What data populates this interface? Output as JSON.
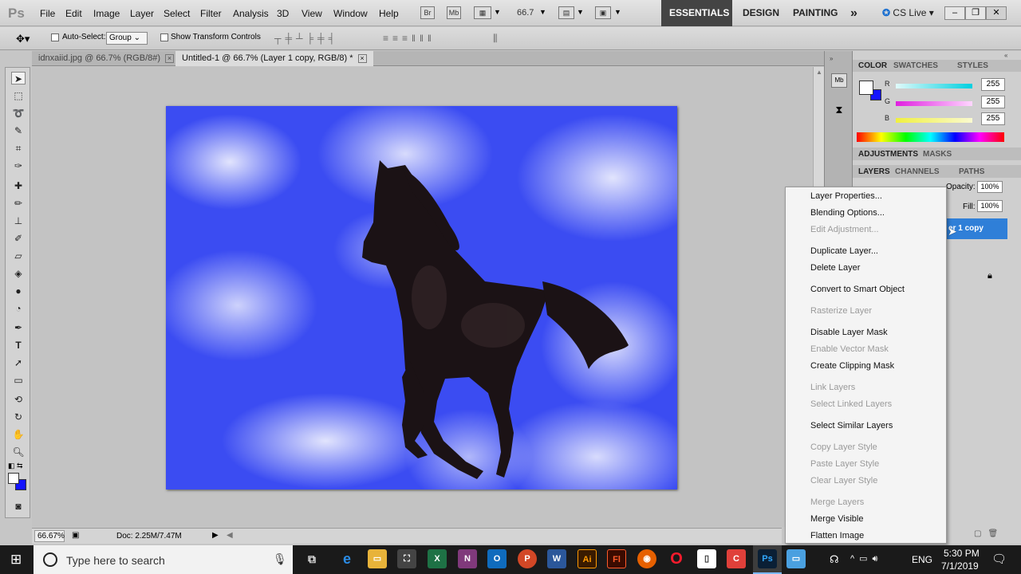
{
  "app": {
    "logo": "Ps"
  },
  "menu": [
    "File",
    "Edit",
    "Image",
    "Layer",
    "Select",
    "Filter",
    "Analysis",
    "3D",
    "View",
    "Window",
    "Help"
  ],
  "menubar_icons": [
    "Br",
    "Mb"
  ],
  "zoom_dropdown": "66.7",
  "workspaces": [
    "ESSENTIALS",
    "DESIGN",
    "PAINTING"
  ],
  "workspace_more": "»",
  "cs_live": "CS Live",
  "options_bar": {
    "auto_select_label": "Auto-Select:",
    "auto_select_value": "Group",
    "transform_label": "Show Transform Controls"
  },
  "doc_tabs": [
    {
      "label": "idnxaiid.jpg @ 66.7% (RGB/8#)",
      "active": false
    },
    {
      "label": "Untitled-1 @ 66.7% (Layer 1 copy, RGB/8) *",
      "active": true
    }
  ],
  "status": {
    "zoom": "66.67%",
    "doc": "Doc: 2.25M/7.47M"
  },
  "panels": {
    "color_tabs": [
      "COLOR",
      "SWATCHES",
      "STYLES"
    ],
    "channels": [
      {
        "label": "R",
        "value": "255",
        "color": "#00c8d8"
      },
      {
        "label": "G",
        "value": "255",
        "color": "#e020e0"
      },
      {
        "label": "B",
        "value": "255",
        "color": "#e0e020"
      }
    ],
    "adjust_tabs": [
      "ADJUSTMENTS",
      "MASKS"
    ],
    "layer_tabs": [
      "LAYERS",
      "CHANNELS",
      "PATHS"
    ],
    "opacity_label": "Opacity:",
    "opacity": "100%",
    "fill_label": "Fill:",
    "fill": "100%",
    "selected_layer": "er 1 copy"
  },
  "context_menu": [
    {
      "label": "Layer Properties...",
      "enabled": true
    },
    {
      "label": "Blending Options...",
      "enabled": true
    },
    {
      "label": "Edit Adjustment...",
      "enabled": false
    },
    {
      "label": "Duplicate Layer...",
      "enabled": true
    },
    {
      "label": "Delete Layer",
      "enabled": true
    },
    {
      "label": "Convert to Smart Object",
      "enabled": true
    },
    {
      "label": "Rasterize Layer",
      "enabled": false
    },
    {
      "label": "Disable Layer Mask",
      "enabled": true
    },
    {
      "label": "Enable Vector Mask",
      "enabled": false
    },
    {
      "label": "Create Clipping Mask",
      "enabled": true
    },
    {
      "label": "Link Layers",
      "enabled": false
    },
    {
      "label": "Select Linked Layers",
      "enabled": false
    },
    {
      "label": "Select Similar Layers",
      "enabled": true
    },
    {
      "label": "Copy Layer Style",
      "enabled": false
    },
    {
      "label": "Paste Layer Style",
      "enabled": false
    },
    {
      "label": "Clear Layer Style",
      "enabled": false
    },
    {
      "label": "Merge Layers",
      "enabled": false
    },
    {
      "label": "Merge Visible",
      "enabled": true
    },
    {
      "label": "Flatten Image",
      "enabled": true
    }
  ],
  "taskbar": {
    "search_placeholder": "Type here to search",
    "time": "5:30 PM",
    "date": "7/1/2019",
    "language": "ENG"
  },
  "colors": {
    "accent": "#3b4cf2",
    "selection": "#2f7fd8"
  }
}
